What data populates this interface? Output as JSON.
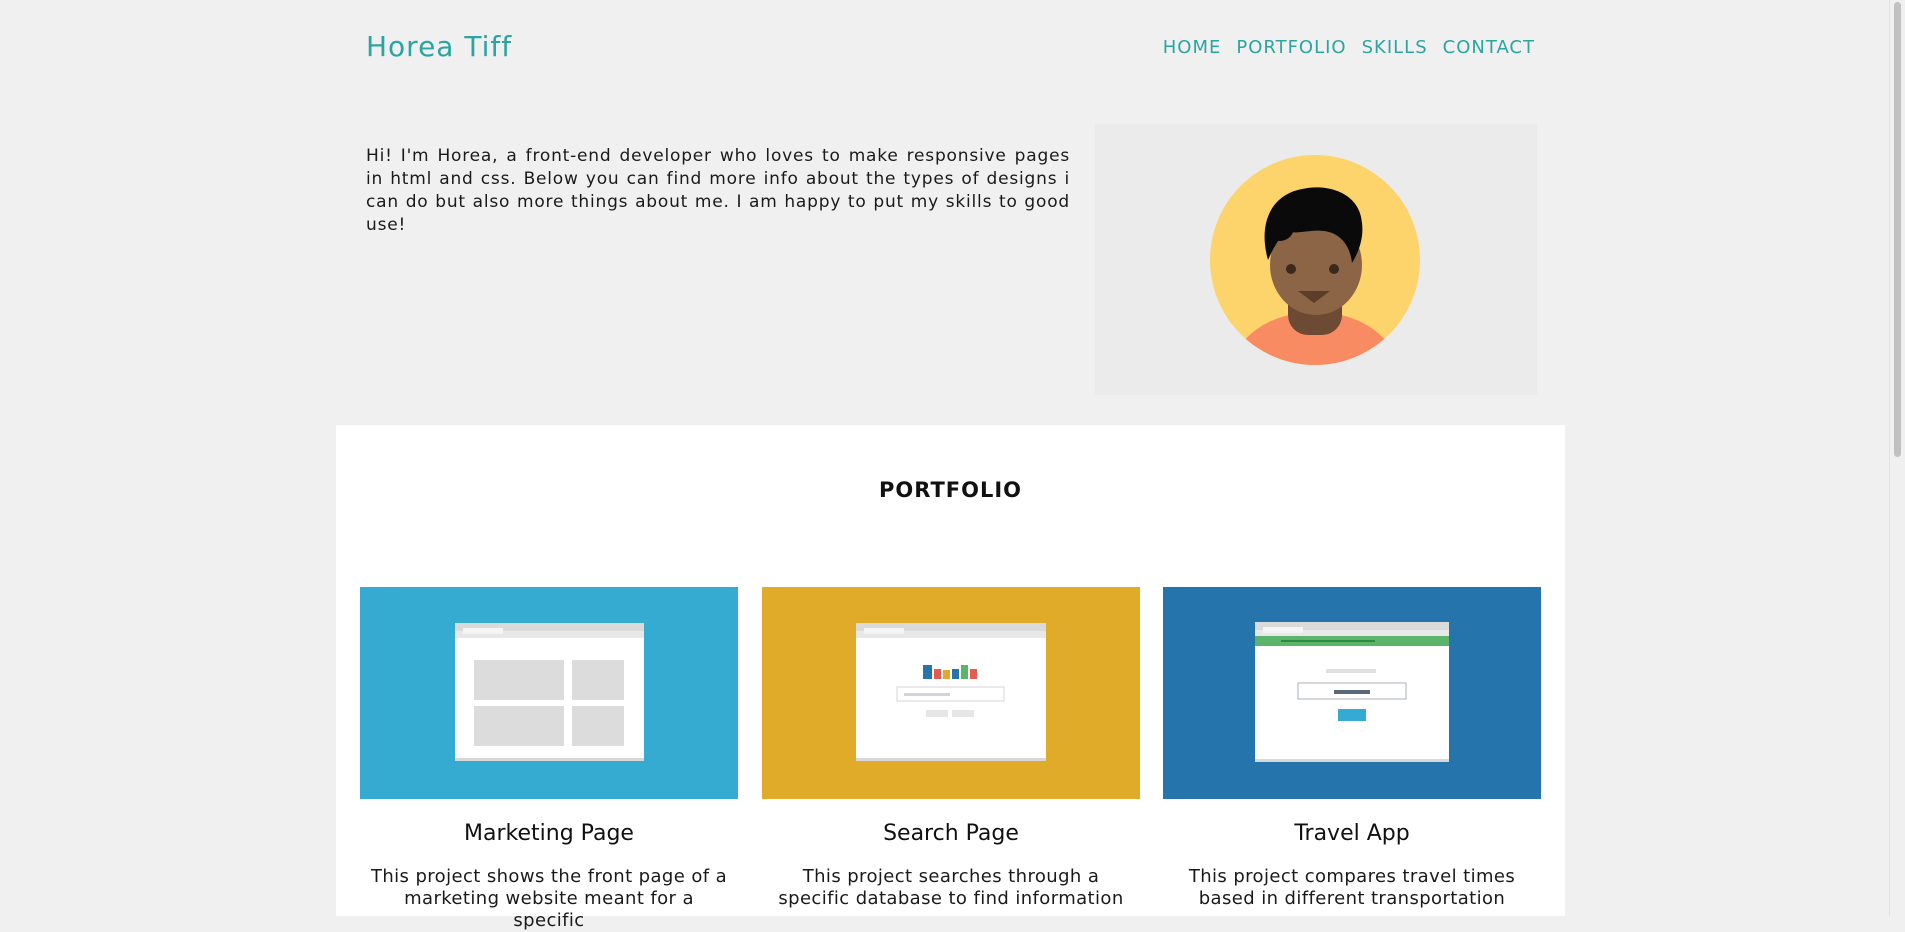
{
  "header": {
    "logo": "Horea Tiff",
    "nav": [
      "HOME",
      "PORTFOLIO",
      "SKILLS",
      "CONTACT"
    ]
  },
  "intro": {
    "text": "Hi! I'm Horea, a front-end developer who loves to make responsive pages in html and css. Below you can find more info about the types of designs i can do but also more things about me. I am happy to put my skills to good use!"
  },
  "portfolio": {
    "title": "PORTFOLIO",
    "cards": [
      {
        "title": "Marketing Page",
        "description": "This project shows the front page of a marketing website meant for a specific",
        "color": "#36abd2"
      },
      {
        "title": "Search Page",
        "description": "This project searches through a specific database to find information",
        "color": "#dfab28"
      },
      {
        "title": "Travel App",
        "description": "This project compares travel times based in different transportation",
        "color": "#2574ab"
      }
    ]
  },
  "colors": {
    "accent": "#2aa5a0",
    "background": "#f0f0f0",
    "avatar_circle": "#fdd36c",
    "avatar_shirt": "#f98b62"
  }
}
